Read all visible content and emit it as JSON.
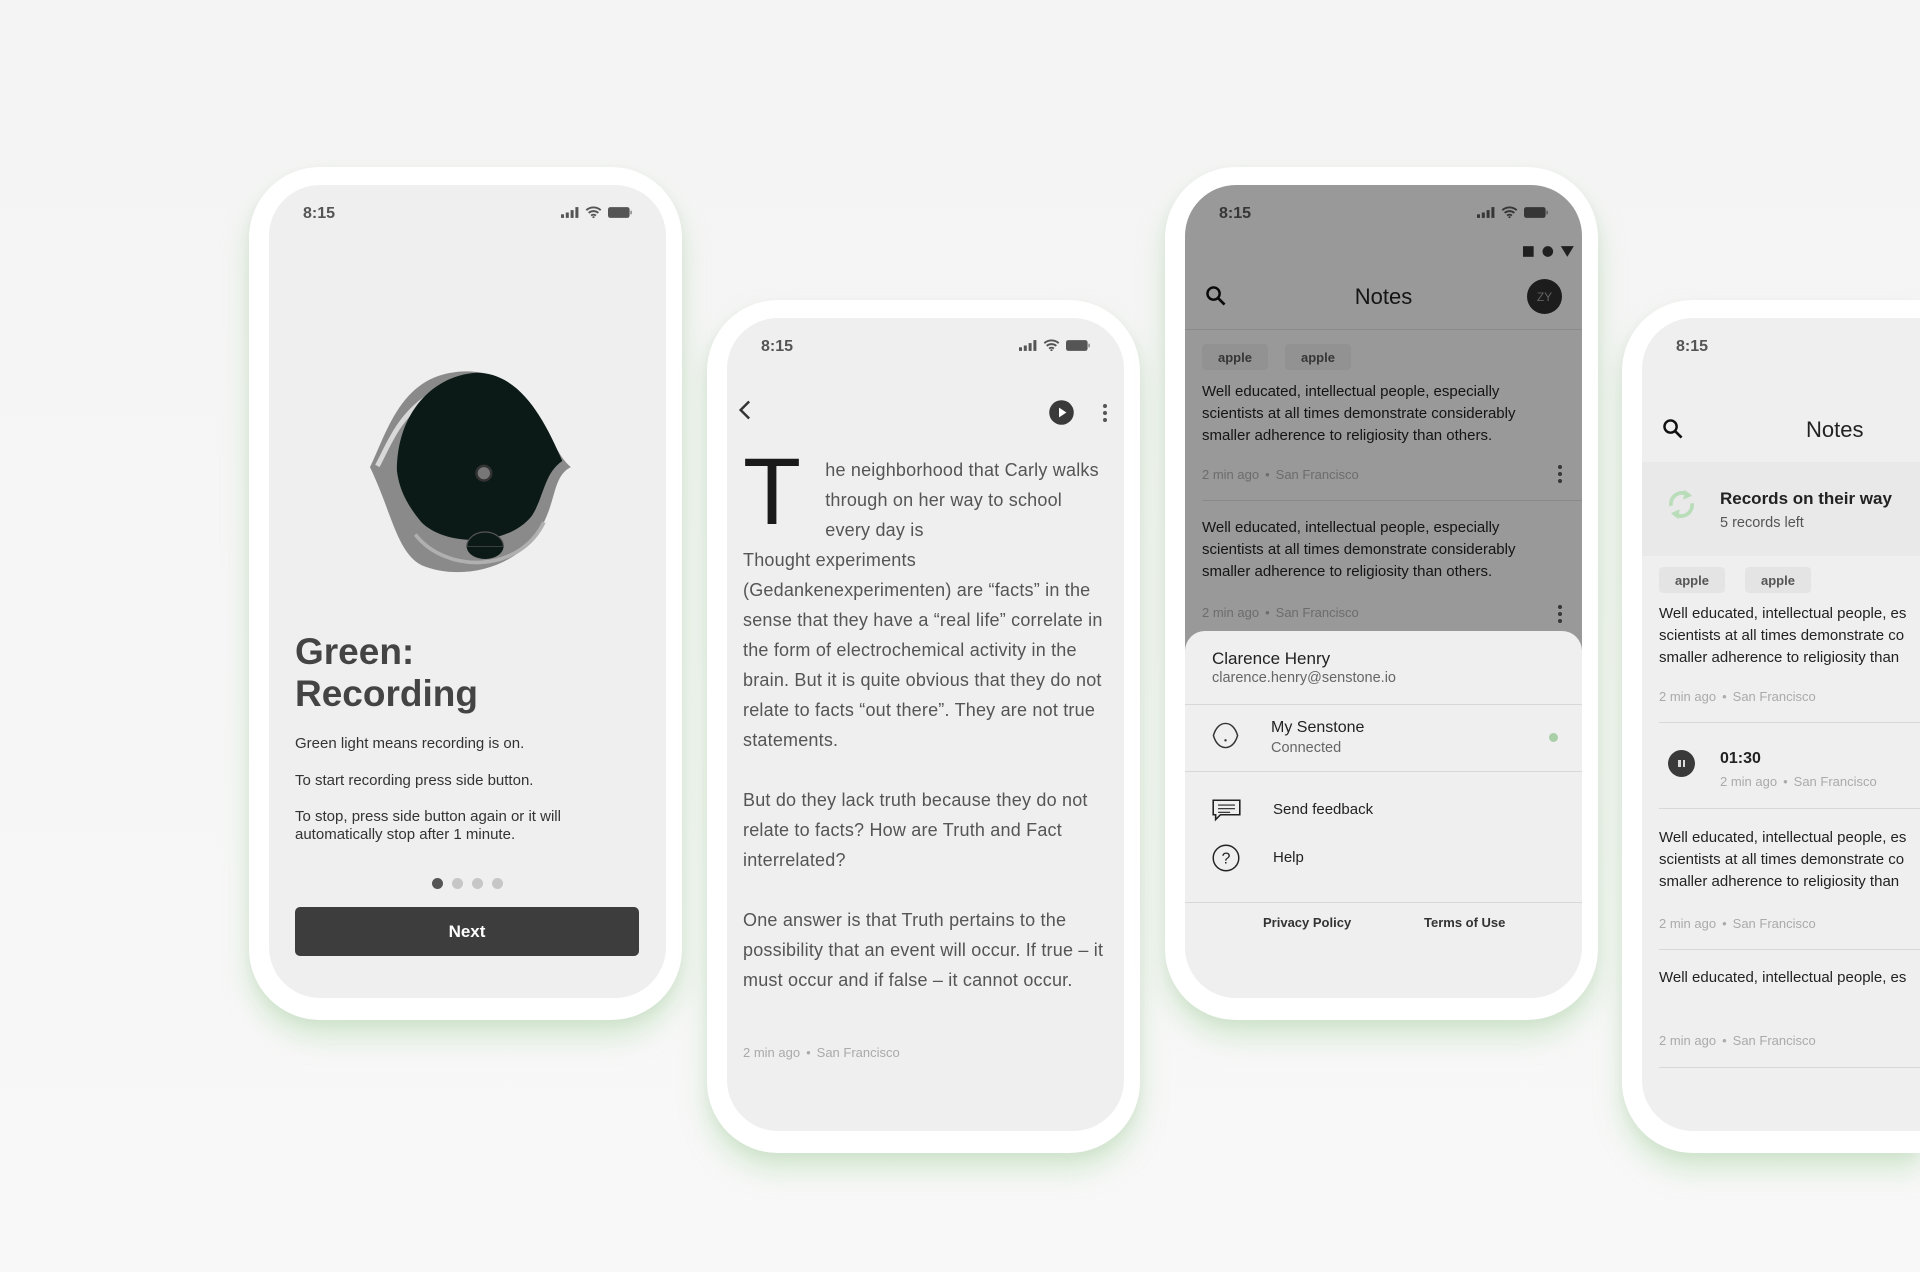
{
  "status_time": "8:15",
  "onboarding": {
    "title_line1": "Green:",
    "title_line2": "Recording",
    "paragraphs": [
      "Green light means recording is on.",
      "To start recording press side button.",
      "To stop, press side button again or it will automatically stop after 1 minute."
    ],
    "page_indicator": {
      "total": 4,
      "current": 1
    },
    "next_label": "Next"
  },
  "article": {
    "dropcap": "T",
    "lead": "he neighborhood that Carly walks through on her way to school every day is",
    "paragraphs": [
      "Thought experiments (Gedankenexperimenten) are “facts” in the sense that they have a “real life” correlate in the form of electrochemical activity in the brain. But it is quite obvious that they do not relate to facts “out there”. They are not true statements.",
      "But do they lack truth because they do not relate to facts? How are Truth and Fact interrelated?",
      "One answer is that Truth pertains to the possibility that an event will occur. If true – it must occur and if false – it cannot occur."
    ],
    "meta_time": "2 min ago",
    "meta_location": "San Francisco"
  },
  "notes_menu": {
    "header_title": "Notes",
    "avatar_initials": "ZY",
    "notes": [
      {
        "tags": [
          "apple",
          "apple"
        ],
        "text": "Well educated, intellectual people, especially\nscientists at all times demonstrate considerably\nsmaller adherence to religiosity than others.",
        "time": "2 min ago",
        "location": "San Francisco"
      },
      {
        "text": "Well educated, intellectual people, especially\nscientists at all times demonstrate considerably\nsmaller adherence to religiosity than others.",
        "time": "2 min ago",
        "location": "San Francisco"
      }
    ],
    "sheet": {
      "user_name": "Clarence Henry",
      "user_email": "clarence.henry@senstone.io",
      "device_name": "My Senstone",
      "device_status": "Connected",
      "device_status_color": "#a8cfa8",
      "send_feedback": "Send feedback",
      "help": "Help",
      "privacy_policy": "Privacy Policy",
      "terms_of_use": "Terms of Use"
    }
  },
  "notes_list": {
    "header_title": "Notes",
    "sync_banner": {
      "title": "Records on their way",
      "subtitle": "5 records left",
      "icon_color": "#b9dcb9"
    },
    "notes": [
      {
        "tags": [
          "apple",
          "apple"
        ],
        "text": "Well educated, intellectual people, es\nscientists at all times demonstrate co\nsmaller adherence to religiosity than",
        "time": "2 min ago",
        "location": "San Francisco"
      },
      {
        "audio_duration": "01:30",
        "time": "2 min ago",
        "location": "San Francisco"
      },
      {
        "text": "Well educated, intellectual people, es\nscientists at all times demonstrate co\nsmaller adherence to religiosity than",
        "time": "2 min ago",
        "location": "San Francisco"
      },
      {
        "text": "Well educated, intellectual people, es",
        "time": "2 min ago",
        "location": "San Francisco"
      }
    ]
  }
}
